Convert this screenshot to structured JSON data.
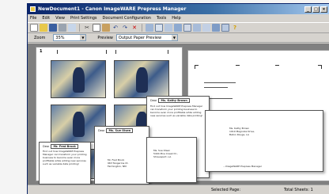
{
  "window": {
    "title": "NewDocument1 - Canon ImageWARE Prepress Manager",
    "controls": [
      "minimize",
      "maximize",
      "close"
    ]
  },
  "menu": [
    "File",
    "Edit",
    "View",
    "Print Settings",
    "Document Configuration",
    "Tools",
    "Help"
  ],
  "toolbar": {
    "icons": [
      "new-icon",
      "open-icon",
      "save-icon",
      "print-icon",
      "preview-icon",
      "cut-icon",
      "copy-icon",
      "paste-icon",
      "undo-icon",
      "redo-icon",
      "delete-icon",
      "insert-icon",
      "page-setup-icon",
      "layout-icon",
      "finishing-icon",
      "staple-icon",
      "punch-icon",
      "fold-icon",
      "booklet-icon",
      "merge-icon",
      "help-icon"
    ]
  },
  "options": {
    "zoom_label": "Zoom",
    "zoom_value": "35%",
    "preview_label": "Preview",
    "preview_value": "Output Paper Preview"
  },
  "document": {
    "page_number": "1",
    "letters": [
      {
        "salutation": "Dear",
        "name": "Ms. Kathy Brown",
        "body": "Find out how ImageWARE Prepress Manager can transform your printing business to become even more profitable while adding new services such as variable data printing!",
        "address": "Ms. Kathy Brown\n1919 Magnolia Drive,\nBaton Rouge, LA",
        "footer": "...ImageWARE Prepress Manager"
      },
      {
        "salutation": "Dear",
        "name": "Mr. Fred Brock",
        "body": "Find out how ImageWARE Prepress Manager can transform your printing business to become even more profitable while adding new services such as variable data printing!",
        "address": "Mr. Fred Brock\n963 Tangerine Ct.\nFarmington, NM",
        "footer": ""
      },
      {
        "salutation": "Dear",
        "name": "Ms. Sue Olsen",
        "body": "",
        "address": "Ms. Sue Olsen\n5404 Pine Creek Dr.,\nShreveport, LA",
        "footer": ""
      }
    ]
  },
  "status": {
    "selected_page_label": "Selected Page:",
    "total_sheets_label": "Total Sheets: 1"
  }
}
